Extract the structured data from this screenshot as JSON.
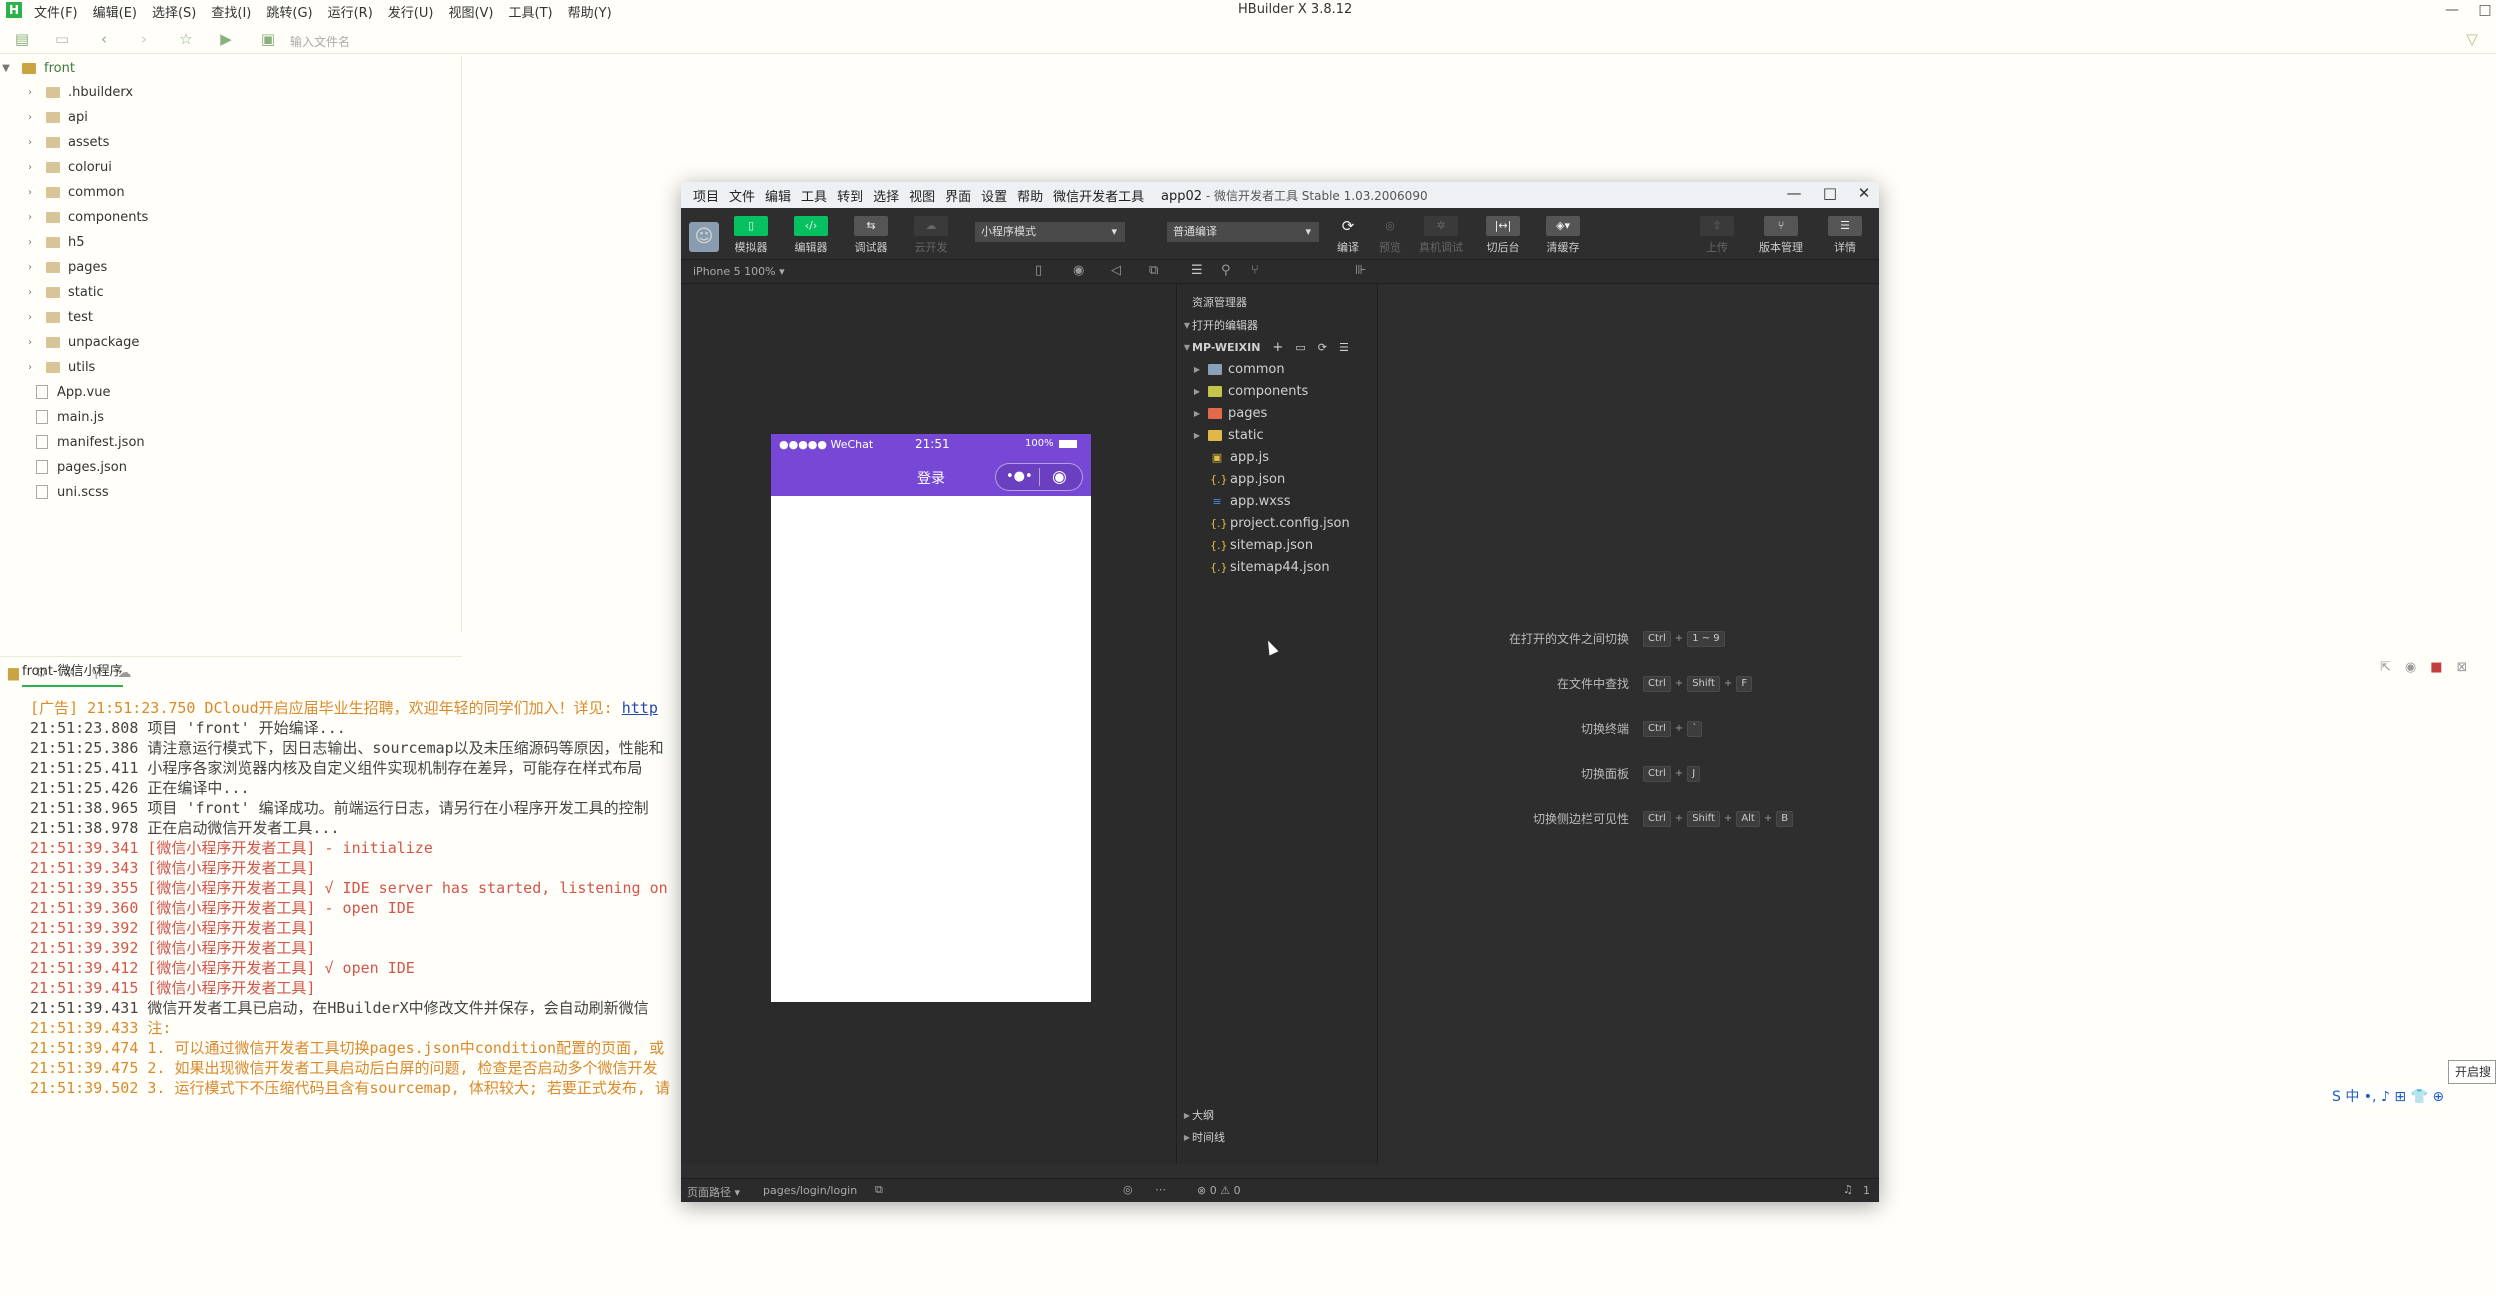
{
  "app": {
    "title": "HBuilder X 3.8.12",
    "logo": "H",
    "menu": [
      "文件(F)",
      "编辑(E)",
      "选择(S)",
      "查找(I)",
      "跳转(G)",
      "运行(R)",
      "发行(U)",
      "视图(V)",
      "工具(T)",
      "帮助(Y)"
    ],
    "search_placeholder": "输入文件名"
  },
  "sidebar": {
    "root": "front",
    "items": [
      {
        "label": ".hbuilderx",
        "type": "folder"
      },
      {
        "label": "api",
        "type": "folder"
      },
      {
        "label": "assets",
        "type": "folder"
      },
      {
        "label": "colorui",
        "type": "folder"
      },
      {
        "label": "common",
        "type": "folder"
      },
      {
        "label": "components",
        "type": "folder"
      },
      {
        "label": "h5",
        "type": "folder"
      },
      {
        "label": "pages",
        "type": "folder"
      },
      {
        "label": "static",
        "type": "folder"
      },
      {
        "label": "test",
        "type": "folder"
      },
      {
        "label": "unpackage",
        "type": "folder"
      },
      {
        "label": "utils",
        "type": "folder"
      },
      {
        "label": "App.vue",
        "type": "file"
      },
      {
        "label": "main.js",
        "type": "file"
      },
      {
        "label": "manifest.json",
        "type": "file"
      },
      {
        "label": "pages.json",
        "type": "file"
      },
      {
        "label": "uni.scss",
        "type": "file"
      }
    ]
  },
  "console": {
    "tab": "front-微信小程序",
    "lines": [
      {
        "t": "[广告] 21:51:23.750 DCloud开启应届毕业生招聘，欢迎年轻的同学们加入！详见: ",
        "c": "ad",
        "link": "http"
      },
      {
        "t": "21:51:23.808 项目 'front' 开始编译...",
        "c": "n"
      },
      {
        "t": "21:51:25.386 请注意运行模式下，因日志输出、sourcemap以及未压缩源码等原因，性能和",
        "c": "n"
      },
      {
        "t": "21:51:25.411 小程序各家浏览器内核及自定义组件实现机制存在差异，可能存在样式布局",
        "c": "n"
      },
      {
        "t": "21:51:25.426 正在编译中...",
        "c": "n"
      },
      {
        "t": "21:51:38.965 项目 'front' 编译成功。前端运行日志，请另行在小程序开发工具的控制",
        "c": "n"
      },
      {
        "t": "21:51:38.978 正在启动微信开发者工具...",
        "c": "n"
      },
      {
        "t": "21:51:39.341 [微信小程序开发者工具] - initialize",
        "c": "r"
      },
      {
        "t": "21:51:39.343 [微信小程序开发者工具]",
        "c": "r"
      },
      {
        "t": "21:51:39.355 [微信小程序开发者工具] √ IDE server has started, listening on",
        "c": "r"
      },
      {
        "t": "21:51:39.360 [微信小程序开发者工具] - open IDE",
        "c": "r"
      },
      {
        "t": "21:51:39.392 [微信小程序开发者工具]",
        "c": "r"
      },
      {
        "t": "21:51:39.392 [微信小程序开发者工具]",
        "c": "r"
      },
      {
        "t": "21:51:39.412 [微信小程序开发者工具] √ open IDE",
        "c": "r"
      },
      {
        "t": "21:51:39.415 [微信小程序开发者工具]",
        "c": "r"
      },
      {
        "t": "21:51:39.431 微信开发者工具已启动，在HBuilderX中修改文件并保存，会自动刷新微信",
        "c": "n"
      },
      {
        "t": "21:51:39.433 注:",
        "c": "ad"
      },
      {
        "t": "21:51:39.474 1. 可以通过微信开发者工具切换pages.json中condition配置的页面, 或",
        "c": "ad"
      },
      {
        "t": "21:51:39.475 2. 如果出现微信开发者工具启动后白屏的问题, 检查是否启动多个微信开发",
        "c": "ad"
      },
      {
        "t": "21:51:39.502 3. 运行模式下不压缩代码且含有sourcemap, 体积较大; 若要正式发布, 请",
        "c": "ad"
      }
    ]
  },
  "ime": {
    "box": "开启搜",
    "label": "S 中 •, ♪ ⊞ 👕 ⊕"
  },
  "wechat": {
    "menu": [
      "项目",
      "文件",
      "编辑",
      "工具",
      "转到",
      "选择",
      "视图",
      "界面",
      "设置",
      "帮助",
      "微信开发者工具"
    ],
    "project": "app02",
    "title_suffix": " - 微信开发者工具 Stable 1.03.2006090",
    "toolbar": {
      "simulator": "模拟器",
      "editor": "编辑器",
      "debugger": "调试器",
      "cloud": "云开发",
      "mode": "小程序模式",
      "compile_mode": "普通编译",
      "compile": "编译",
      "preview": "预览",
      "real_debug": "真机调试",
      "background": "切后台",
      "clear_cache": "清缓存",
      "upload": "上传",
      "version": "版本管理",
      "details": "详情"
    },
    "device": "iPhone 5 100% ▾",
    "phone": {
      "carrier": "●●●●● WeChat",
      "time": "21:51",
      "battery": "100%",
      "page_title": "登录",
      "capsule_dots": "•●•"
    },
    "explorer": {
      "header": "资源管理器",
      "open_editors": "打开的编辑器",
      "project": "MP-WEIXIN",
      "items": [
        {
          "label": "common",
          "type": "folder",
          "color": "#8aa0b8"
        },
        {
          "label": "components",
          "type": "folder",
          "color": "#c4c44a"
        },
        {
          "label": "pages",
          "type": "folder",
          "color": "#e06a4a"
        },
        {
          "label": "static",
          "type": "folder",
          "color": "#e0b84a"
        },
        {
          "label": "app.js",
          "type": "file",
          "icon": "▣",
          "color": "#e0c040"
        },
        {
          "label": "app.json",
          "type": "file",
          "icon": "{.}",
          "color": "#e0c040"
        },
        {
          "label": "app.wxss",
          "type": "file",
          "icon": "≡",
          "color": "#4a8ae0"
        },
        {
          "label": "project.config.json",
          "type": "file",
          "icon": "{.}",
          "color": "#e0c040"
        },
        {
          "label": "sitemap.json",
          "type": "file",
          "icon": "{.}",
          "color": "#e0c040"
        },
        {
          "label": "sitemap44.json",
          "type": "file",
          "icon": "{.}",
          "color": "#e0c040"
        }
      ],
      "outline": "大纲",
      "timeline": "时间线"
    },
    "shortcuts": [
      {
        "label": "在打开的文件之间切换",
        "keys": [
          "Ctrl",
          "1 ~ 9"
        ]
      },
      {
        "label": "在文件中查找",
        "keys": [
          "Ctrl",
          "Shift",
          "F"
        ]
      },
      {
        "label": "切换终端",
        "keys": [
          "Ctrl",
          "`"
        ]
      },
      {
        "label": "切换面板",
        "keys": [
          "Ctrl",
          "J"
        ]
      },
      {
        "label": "切换侧边栏可见性",
        "keys": [
          "Ctrl",
          "Shift",
          "Alt",
          "B"
        ]
      }
    ],
    "status": {
      "path_label": "页面路径 ▾",
      "path": "pages/login/login",
      "errors": "⊗ 0 ⚠ 0",
      "notifications": "1"
    }
  }
}
